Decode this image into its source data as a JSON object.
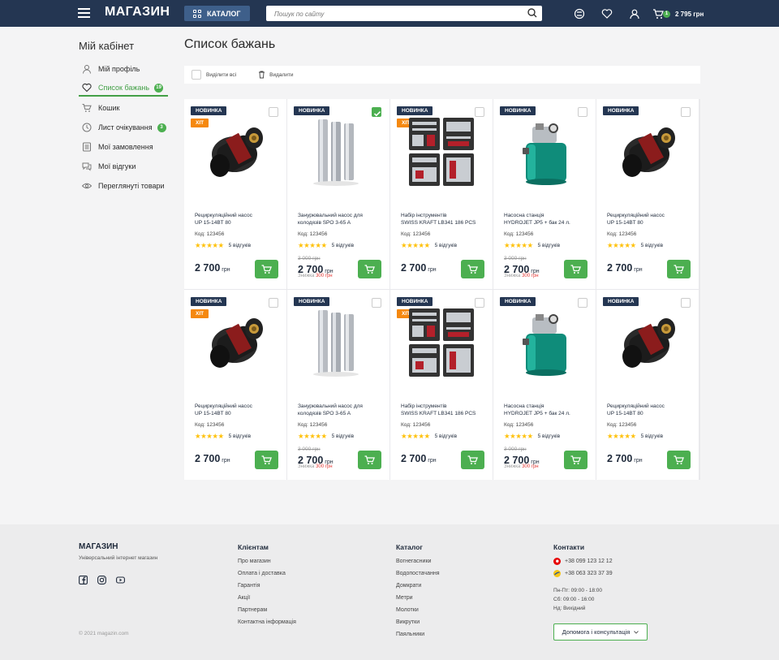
{
  "header": {
    "logo": "МАГАЗИН",
    "catalog_label": "КАТАЛОГ",
    "search_placeholder": "Пошук по сайту",
    "cart_count": "1",
    "cart_total": "2 795 грн"
  },
  "sidebar": {
    "title": "Мій кабінет",
    "items": [
      {
        "label": "Мій профіль",
        "icon": "user-icon"
      },
      {
        "label": "Список бажань",
        "icon": "heart-icon",
        "count": "19",
        "active": true
      },
      {
        "label": "Кошик",
        "icon": "cart-icon"
      },
      {
        "label": "Лист очікування",
        "icon": "clock-icon",
        "count": "3"
      },
      {
        "label": "Мої замовлення",
        "icon": "orders-icon"
      },
      {
        "label": "Мої відгуки",
        "icon": "reviews-icon"
      },
      {
        "label": "Переглянуті товари",
        "icon": "eye-icon"
      }
    ]
  },
  "main": {
    "title": "Список бажань",
    "select_all": "Виділити всі",
    "delete": "Видалити"
  },
  "products": [
    {
      "new": "НОВИНКА",
      "hit": "ХІТ",
      "checked": false,
      "image": "pump",
      "name1": "Рециркуляційний насос",
      "name2": "UP 15-14BT 80",
      "code": "Код: 123456",
      "stars": "★★★★★",
      "reviews": "5 відгуків",
      "old_price": "",
      "price": "2 700",
      "currency": "грн",
      "disc_label": "",
      "disc_value": ""
    },
    {
      "new": "НОВИНКА",
      "hit": "",
      "checked": true,
      "image": "well",
      "name1": "Занурювальний насос для",
      "name2": "колодязів SPO 3-65 A",
      "code": "Код: 123456",
      "stars": "★★★★★",
      "reviews": "5 відгуків",
      "old_price": "3 000 грн",
      "price": "2 700",
      "currency": "грн",
      "disc_label": "Знижка",
      "disc_value": "300 грн"
    },
    {
      "new": "НОВИНКА",
      "hit": "ХІТ",
      "checked": false,
      "image": "tools",
      "name1": "Набір інструментів",
      "name2": "SWISS KRAFT LB341 186 PCS",
      "code": "Код: 123456",
      "stars": "★★★★★",
      "reviews": "5 відгуків",
      "old_price": "",
      "price": "2 700",
      "currency": "грн",
      "disc_label": "",
      "disc_value": ""
    },
    {
      "new": "НОВИНКА",
      "hit": "",
      "checked": false,
      "image": "station",
      "name1": "Насосна станція",
      "name2": "HYDROJET JP5 + бак 24 л.",
      "code": "Код: 123456",
      "stars": "★★★★★",
      "reviews": "5 відгуків",
      "old_price": "3 000 грн",
      "price": "2 700",
      "currency": "грн",
      "disc_label": "Знижка",
      "disc_value": "300 грн"
    },
    {
      "new": "НОВИНКА",
      "hit": "",
      "checked": false,
      "image": "pump",
      "name1": "Рециркуляційний насос",
      "name2": "UP 15-14BT 80",
      "code": "Код: 123456",
      "stars": "★★★★★",
      "reviews": "5 відгуків",
      "old_price": "",
      "price": "2 700",
      "currency": "грн",
      "disc_label": "",
      "disc_value": ""
    },
    {
      "new": "НОВИНКА",
      "hit": "ХІТ",
      "checked": false,
      "image": "pump",
      "name1": "Рециркуляційний насос",
      "name2": "UP 15-14BT 80",
      "code": "Код: 123456",
      "stars": "★★★★★",
      "reviews": "5 відгуків",
      "old_price": "",
      "price": "2 700",
      "currency": "грн",
      "disc_label": "",
      "disc_value": ""
    },
    {
      "new": "НОВИНКА",
      "hit": "",
      "checked": false,
      "image": "well",
      "name1": "Занурювальний насос для",
      "name2": "колодязів SPO 3-65 A",
      "code": "Код: 123456",
      "stars": "★★★★★",
      "reviews": "5 відгуків",
      "old_price": "3 000 грн",
      "price": "2 700",
      "currency": "грн",
      "disc_label": "Знижка",
      "disc_value": "300 грн"
    },
    {
      "new": "НОВИНКА",
      "hit": "ХІТ",
      "checked": false,
      "image": "tools",
      "name1": "Набір інструментів",
      "name2": "SWISS KRAFT LB341 186 PCS",
      "code": "Код: 123456",
      "stars": "★★★★★",
      "reviews": "5 відгуків",
      "old_price": "",
      "price": "2 700",
      "currency": "грн",
      "disc_label": "",
      "disc_value": ""
    },
    {
      "new": "НОВИНКА",
      "hit": "",
      "checked": false,
      "image": "station",
      "name1": "Насосна станція",
      "name2": "HYDROJET JP5 + бак 24 л.",
      "code": "Код: 123456",
      "stars": "★★★★★",
      "reviews": "5 відгуків",
      "old_price": "3 000 грн",
      "price": "2 700",
      "currency": "грн",
      "disc_label": "Знижка",
      "disc_value": "300 грн"
    },
    {
      "new": "НОВИНКА",
      "hit": "",
      "checked": false,
      "image": "pump",
      "name1": "Рециркуляційний насос",
      "name2": "UP 15-14BT 80",
      "code": "Код: 123456",
      "stars": "★★★★★",
      "reviews": "5 відгуків",
      "old_price": "",
      "price": "2 700",
      "currency": "грн",
      "disc_label": "",
      "disc_value": ""
    }
  ],
  "footer": {
    "logo": "МАГАЗИН",
    "subtitle": "Універсальний інтернет магазин",
    "copyright": "© 2021 magazin.com",
    "clients_title": "Клієнтам",
    "clients": [
      "Про магазин",
      "Оплата і доставка",
      "Гарантія",
      "Акції",
      "Партнерам",
      "Контактна інформація"
    ],
    "catalog_title": "Каталог",
    "catalog": [
      "Вогнегасники",
      "Водопостачання",
      "Домкрати",
      "Метри",
      "Молотки",
      "Викрутки",
      "Паяльники"
    ],
    "contacts_title": "Контакти",
    "phone1": "+38 099 123 12 12",
    "phone2": "+38 063 323 37 39",
    "hours1": "Пн-Пт: 09:00 - 18:00",
    "hours2": "Сб: 09:00 - 16:00",
    "hours3": "Нд: Вихідний",
    "help": "Допомога і консультація"
  },
  "colors": {
    "header_bg": "#243652",
    "accent_green": "#4caf50",
    "badge_new": "#243652",
    "badge_hit": "#f5880f",
    "star": "#ffc107",
    "discount_red": "#e53935"
  }
}
